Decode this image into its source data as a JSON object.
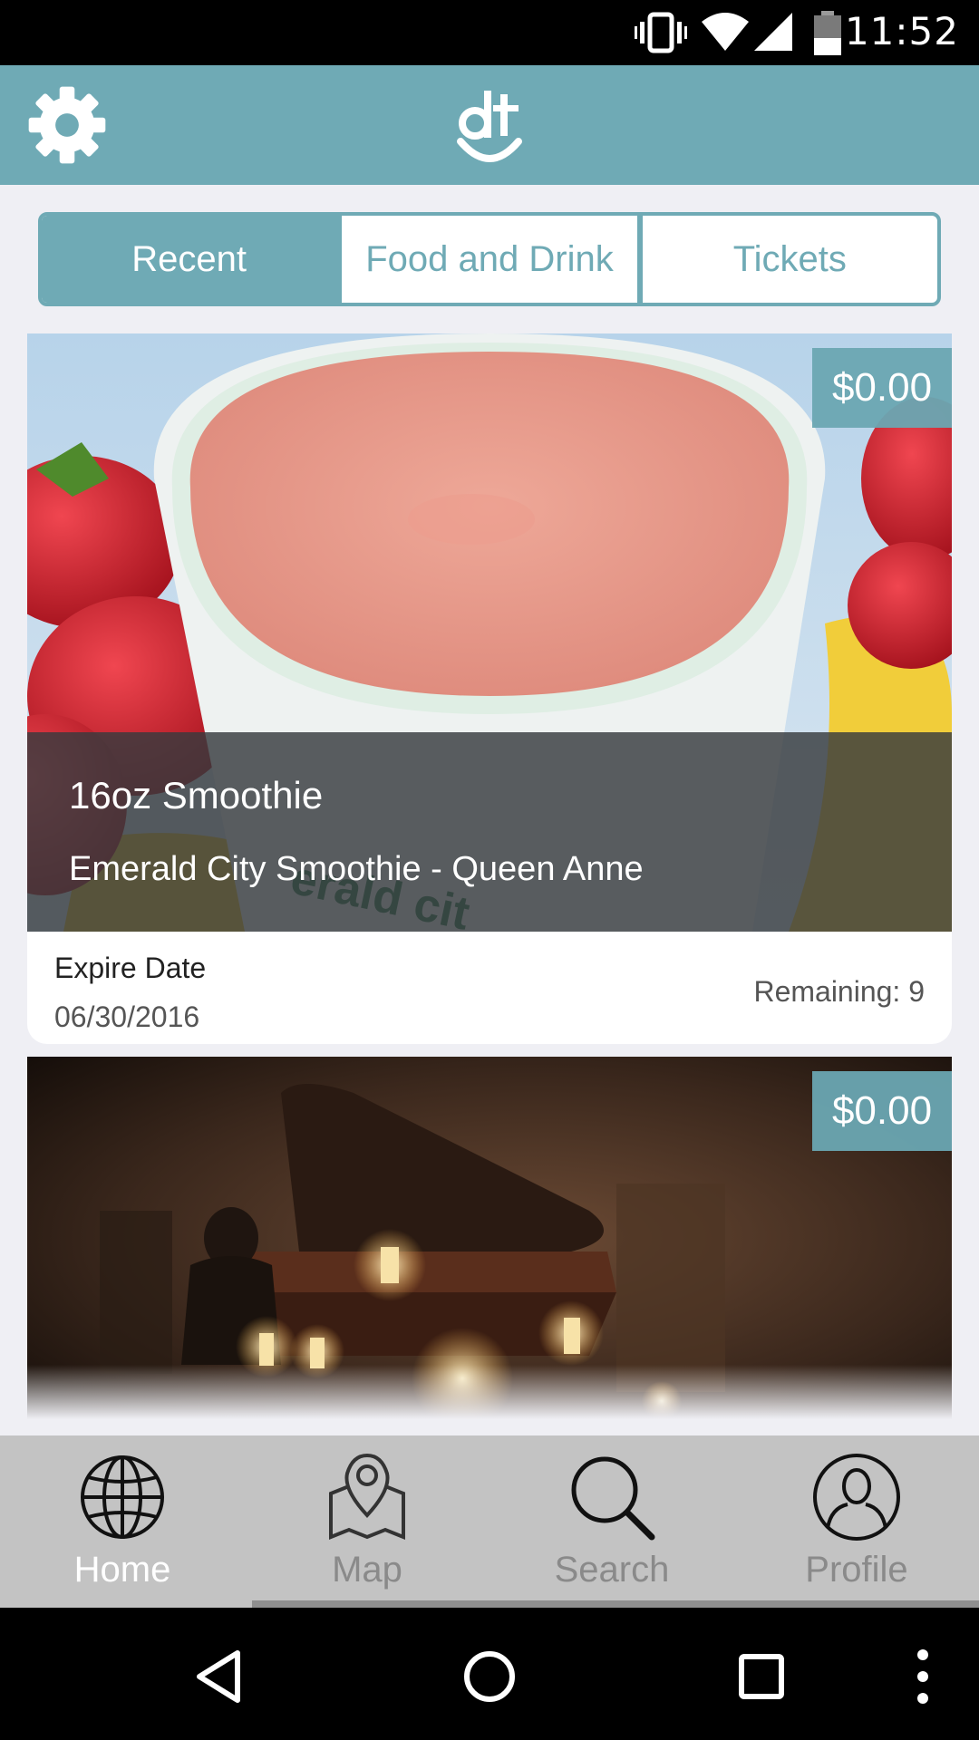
{
  "status_bar": {
    "time": "11:52",
    "icons": [
      "vibrate-icon",
      "wifi-icon",
      "signal-icon",
      "battery-icon"
    ]
  },
  "header": {
    "left_icon": "gear-icon",
    "logo_text": "dt"
  },
  "tabs": [
    {
      "label": "Recent",
      "active": true
    },
    {
      "label": "Food and Drink",
      "active": false
    },
    {
      "label": "Tickets",
      "active": false
    }
  ],
  "cards": [
    {
      "price": "$0.00",
      "title": "16oz Smoothie",
      "subtitle": "Emerald City Smoothie  - Queen Anne",
      "expire_label": "Expire Date",
      "expire_date": "06/30/2016",
      "remaining": "Remaining: 9",
      "image_subject": "strawberry smoothie in a cup"
    },
    {
      "price": "$0.00",
      "image_subject": "grand piano with candles"
    }
  ],
  "bottom_nav": [
    {
      "label": "Home",
      "icon": "globe-icon",
      "active": true
    },
    {
      "label": "Map",
      "icon": "map-pin-icon",
      "active": false
    },
    {
      "label": "Search",
      "icon": "search-icon",
      "active": false
    },
    {
      "label": "Profile",
      "icon": "profile-icon",
      "active": false
    }
  ],
  "system_nav": [
    "back-icon",
    "home-icon",
    "recents-icon",
    "more-icon"
  ],
  "colors": {
    "accent": "#6faab5",
    "background": "#efeff4",
    "nav_bar": "#c3c3c3"
  }
}
